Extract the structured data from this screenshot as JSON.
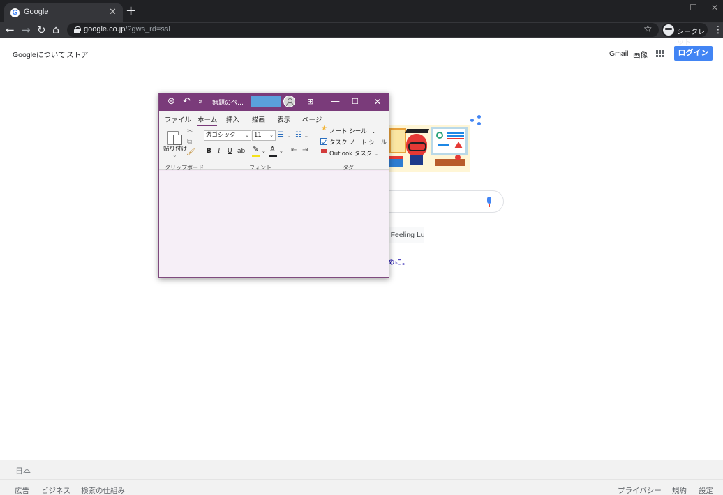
{
  "browser": {
    "tab_title": "Google",
    "tab_favicon": "G",
    "tab_close": "✕",
    "new_tab": "+",
    "window_controls": [
      "—",
      "☐",
      "✕"
    ],
    "nav_icons": [
      "arrow-left-icon",
      "arrow-right-icon",
      "reload-icon",
      "home-icon"
    ],
    "nav_glyphs": [
      "←",
      "→",
      "↻",
      "⌂"
    ],
    "url_host": "google.co.jp",
    "url_path": "/?gws_rd=ssl",
    "bookmark_star": "☆",
    "incognito_label": "シークレット",
    "menu": "⋮"
  },
  "google": {
    "top_left_links": [
      "Googleについて",
      "ストア"
    ],
    "top_right_links": [
      "Gmail",
      "画像"
    ],
    "login_label": "ログイン",
    "lucky_label": "I'm Feeling Lucky",
    "promo_text": "めに。",
    "footer_country": "日本",
    "footer_left": [
      "広告",
      "ビジネス",
      "検索の仕組み"
    ],
    "footer_right": [
      "プライバシー",
      "規約",
      "設定"
    ],
    "accent_color": "#4285f4"
  },
  "onenote": {
    "title_buttons": [
      "⊝",
      "↶",
      "»"
    ],
    "doc_title": "無題のペ…",
    "window_buttons": [
      "⊞",
      "—",
      "☐",
      "✕"
    ],
    "tabs": [
      "ファイル",
      "ホーム",
      "挿入",
      "描画",
      "表示",
      "ページ"
    ],
    "active_tab": "ホーム",
    "clipboard": {
      "paste_label": "貼り付け",
      "paste_arrow": "⌄",
      "cut": "✂",
      "copy": "⧉",
      "format_painter": "🖌",
      "group_label": "クリップボード"
    },
    "font": {
      "font_name": "游ゴシック",
      "font_size": "11",
      "bold": "B",
      "italic": "I",
      "underline": "U",
      "strike": "ab",
      "highlight": "✎",
      "font_color": "A",
      "bullets": "☰",
      "numbering": "☷",
      "outdent": "⇤",
      "indent": "⇥",
      "dropdown": "⌄",
      "group_label": "フォント"
    },
    "tags": {
      "items": [
        "ノート シール",
        "タスク ノート シール",
        "Outlook タスク"
      ],
      "dropdown": "⌄",
      "group_label": "タグ"
    },
    "theme_color": "#7a3b7a"
  }
}
